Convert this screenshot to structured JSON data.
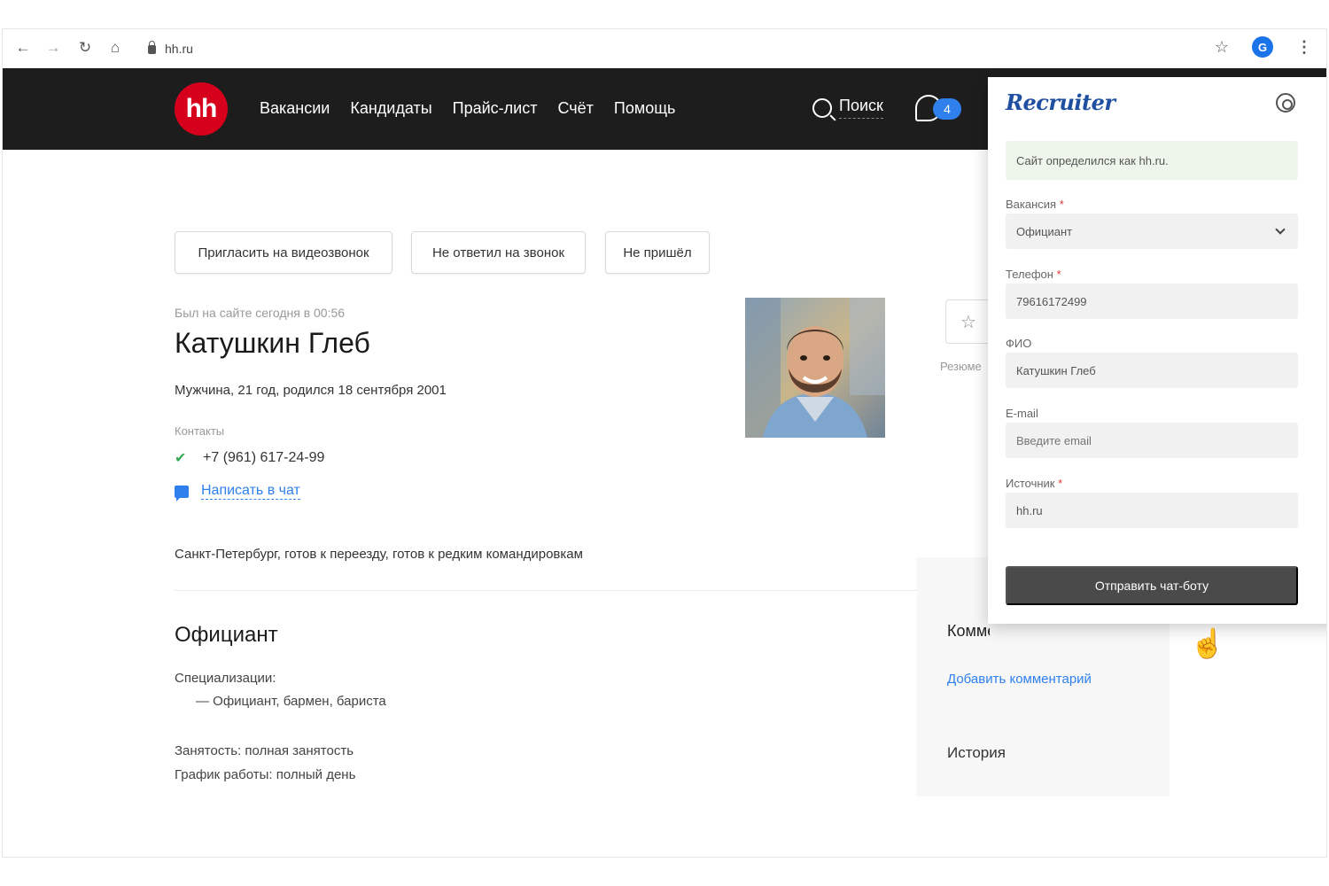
{
  "browser": {
    "url": "hh.ru",
    "profile_initial": "G"
  },
  "header": {
    "logo": "hh",
    "nav": [
      "Вакансии",
      "Кандидаты",
      "Прайс-лист",
      "Счёт",
      "Помощь"
    ],
    "search_label": "Поиск",
    "notification_count": "4"
  },
  "actions": [
    "Пригласить на видеозвонок",
    "Не ответил на звонок",
    "Не пришёл"
  ],
  "resume": {
    "last_seen": "Был на сайте сегодня в 00:56",
    "name": "Катушкин Глеб",
    "personal": "Мужчина, 21 год, родился 18 сентября 2001",
    "contacts_label": "Контакты",
    "phone": "+7 (961) 617-24-99",
    "chat_link": "Написать в чат",
    "city": "Санкт-Петербург, готов к переезду, готов к редким командировкам",
    "position": "Официант",
    "specializations_label": "Специализации:",
    "specialization": "— Официант, бармен, бариста",
    "employment": "Занятость: полная занятость",
    "schedule": "График работы: полный день"
  },
  "sidebar": {
    "resume_label": "Резюме",
    "comments_title": "Комментарии",
    "add_comment": "Добавить комментарий",
    "history_title": "История"
  },
  "popup": {
    "logo": "Recruiter",
    "notice": "Сайт определился как hh.ru.",
    "vacancy_label": "Вакансия",
    "vacancy_value": "Официант",
    "phone_label": "Телефон",
    "phone_value": "79616172499",
    "fio_label": "ФИО",
    "fio_value": "Катушкин Глеб",
    "email_label": "E-mail",
    "email_placeholder": "Введите email",
    "source_label": "Источник",
    "source_value": "hh.ru",
    "send_button": "Отправить чат-боту"
  },
  "colors": {
    "hh_red": "#d6001c",
    "header_bg": "#1d1d1d",
    "link_blue": "#2f80ed",
    "notice_bg": "#eef6ec",
    "button_dark": "#4a4a4a"
  }
}
